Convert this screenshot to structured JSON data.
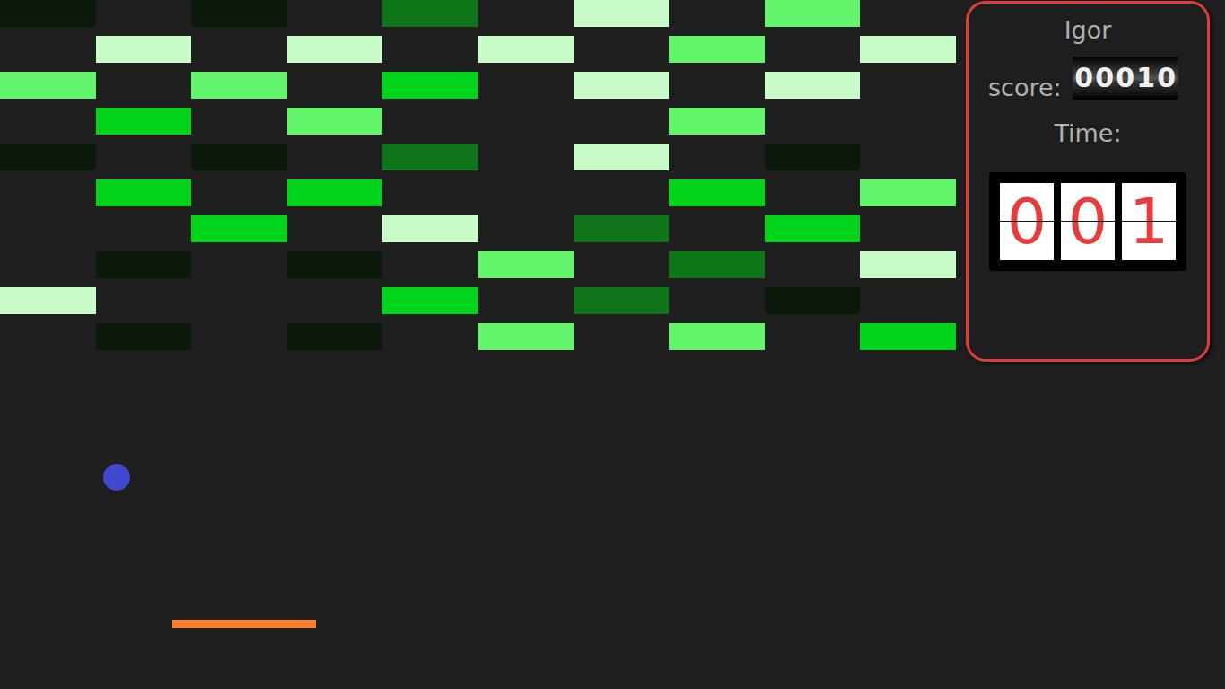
{
  "player": {
    "name": "Igor"
  },
  "score": {
    "label": "score:",
    "digits": [
      "0",
      "0",
      "0",
      "1",
      "0"
    ]
  },
  "time": {
    "label": "Time:",
    "digits": [
      "0",
      "0",
      "1"
    ]
  },
  "bricks": [
    [
      {
        "present": true,
        "color": "#0a190a"
      },
      {
        "present": false
      },
      {
        "present": true,
        "color": "#0a190a"
      },
      {
        "present": false
      },
      {
        "present": true,
        "color": "#10761a"
      },
      {
        "present": false
      },
      {
        "present": true,
        "color": "#c8fcc8"
      },
      {
        "present": false
      },
      {
        "present": true,
        "color": "#62f46b"
      },
      {
        "present": false
      }
    ],
    [
      {
        "present": false
      },
      {
        "present": true,
        "color": "#c8fcc8"
      },
      {
        "present": false
      },
      {
        "present": true,
        "color": "#c8fcc8"
      },
      {
        "present": false
      },
      {
        "present": true,
        "color": "#c8fcc8"
      },
      {
        "present": false
      },
      {
        "present": true,
        "color": "#62f46b"
      },
      {
        "present": false
      },
      {
        "present": true,
        "color": "#c8fcc8"
      }
    ],
    [
      {
        "present": true,
        "color": "#62f46b"
      },
      {
        "present": false
      },
      {
        "present": true,
        "color": "#62f46b"
      },
      {
        "present": false
      },
      {
        "present": true,
        "color": "#00d41a"
      },
      {
        "present": false
      },
      {
        "present": true,
        "color": "#c8fcc8"
      },
      {
        "present": false
      },
      {
        "present": true,
        "color": "#c8fcc8"
      },
      {
        "present": false
      }
    ],
    [
      {
        "present": false
      },
      {
        "present": true,
        "color": "#00d41a"
      },
      {
        "present": false
      },
      {
        "present": true,
        "color": "#62f46b"
      },
      {
        "present": false
      },
      {
        "present": false
      },
      {
        "present": false
      },
      {
        "present": true,
        "color": "#62f46b"
      },
      {
        "present": false
      },
      {
        "present": false
      }
    ],
    [
      {
        "present": true,
        "color": "#0a190a"
      },
      {
        "present": false
      },
      {
        "present": true,
        "color": "#0a190a"
      },
      {
        "present": false
      },
      {
        "present": true,
        "color": "#10761a"
      },
      {
        "present": false
      },
      {
        "present": true,
        "color": "#c8fcc8"
      },
      {
        "present": false
      },
      {
        "present": true,
        "color": "#0a190a"
      },
      {
        "present": false
      }
    ],
    [
      {
        "present": false
      },
      {
        "present": true,
        "color": "#00d41a"
      },
      {
        "present": false
      },
      {
        "present": true,
        "color": "#00d41a"
      },
      {
        "present": false
      },
      {
        "present": false
      },
      {
        "present": false
      },
      {
        "present": true,
        "color": "#00d41a"
      },
      {
        "present": false
      },
      {
        "present": true,
        "color": "#62f46b"
      }
    ],
    [
      {
        "present": false
      },
      {
        "present": false
      },
      {
        "present": true,
        "color": "#00d41a"
      },
      {
        "present": false
      },
      {
        "present": true,
        "color": "#c8fcc8"
      },
      {
        "present": false
      },
      {
        "present": true,
        "color": "#10761a"
      },
      {
        "present": false
      },
      {
        "present": true,
        "color": "#00d41a"
      },
      {
        "present": false
      }
    ],
    [
      {
        "present": false
      },
      {
        "present": true,
        "color": "#0a190a"
      },
      {
        "present": false
      },
      {
        "present": true,
        "color": "#0a190a"
      },
      {
        "present": false
      },
      {
        "present": true,
        "color": "#62f46b"
      },
      {
        "present": false
      },
      {
        "present": true,
        "color": "#10761a"
      },
      {
        "present": false
      },
      {
        "present": true,
        "color": "#c8fcc8"
      }
    ],
    [
      {
        "present": true,
        "color": "#c8fcc8"
      },
      {
        "present": false
      },
      {
        "present": false
      },
      {
        "present": false
      },
      {
        "present": true,
        "color": "#00d41a"
      },
      {
        "present": false
      },
      {
        "present": true,
        "color": "#10761a"
      },
      {
        "present": false
      },
      {
        "present": true,
        "color": "#0a190a"
      },
      {
        "present": false
      }
    ],
    [
      {
        "present": false
      },
      {
        "present": true,
        "color": "#0a190a"
      },
      {
        "present": false
      },
      {
        "present": true,
        "color": "#0a190a"
      },
      {
        "present": false
      },
      {
        "present": true,
        "color": "#62f46b"
      },
      {
        "present": false
      },
      {
        "present": true,
        "color": "#62f46b"
      },
      {
        "present": false
      },
      {
        "present": true,
        "color": "#00d41a"
      }
    ]
  ]
}
